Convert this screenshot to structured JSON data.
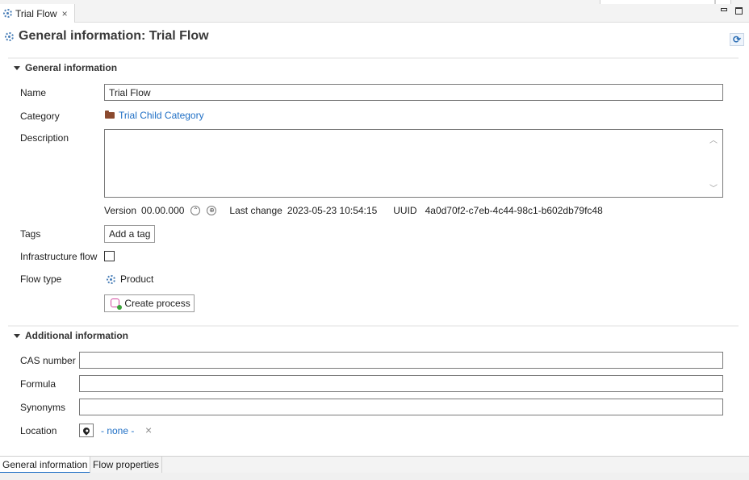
{
  "editor_tab": {
    "label": "Trial Flow",
    "close": "×"
  },
  "header": {
    "title": "General information: Trial Flow",
    "refresh_glyph": "⟳"
  },
  "sections": {
    "general": "General information",
    "additional": "Additional information"
  },
  "general": {
    "name_label": "Name",
    "name_value": "Trial Flow",
    "category_label": "Category",
    "category_value": "Trial Child Category",
    "description_label": "Description",
    "description_value": "",
    "version_label": "Version",
    "version_value": "00.00.000",
    "version_up": "⌃",
    "version_lock": "⊕",
    "last_change_label": "Last change",
    "last_change_value": "2023-05-23 10:54:15",
    "uuid_label": "UUID",
    "uuid_value": "4a0d70f2-c7eb-4c44-98c1-b602db79fc48",
    "tags_label": "Tags",
    "add_tag": "Add a tag",
    "infra_label": "Infrastructure flow",
    "infra_checked": false,
    "flow_type_label": "Flow type",
    "flow_type_value": "Product",
    "create_process": "Create process"
  },
  "additional": {
    "cas_label": "CAS number",
    "cas_value": "",
    "formula_label": "Formula",
    "formula_value": "",
    "synonyms_label": "Synonyms",
    "synonyms_value": "",
    "location_label": "Location",
    "location_value": "- none -",
    "location_clear": "×"
  },
  "bottom_tabs": [
    {
      "label": "General information",
      "active": true
    },
    {
      "label": "Flow properties",
      "active": false
    }
  ],
  "colors": {
    "link": "#1f6fc5",
    "folder": "#8b4a2f",
    "flow_icon": "#4a7fb8"
  },
  "icons": [
    "flow-gear-icon",
    "folder-icon",
    "refresh-icon",
    "location-pin-icon",
    "create-process-icon",
    "close-icon"
  ]
}
